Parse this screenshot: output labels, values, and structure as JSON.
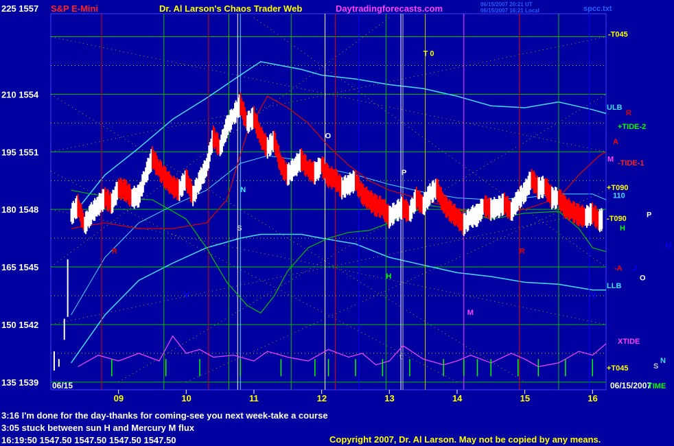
{
  "header": {
    "left_label": "225 1557",
    "instrument": "S&P E-Mini",
    "title": "Dr. Al Larson's Chaos Trader Web",
    "site": "Daytradingforecasts.com",
    "stamp_line1": "06/15/2007 20:21 UT",
    "stamp_line2": "06/15/2007 16:21 Local",
    "file": "spcc.txt"
  },
  "colors": {
    "background": "#0000a0",
    "price_up": "#ffffff",
    "price_down": "#ff0000",
    "grid_green": "#00c000",
    "grid_yellow": "#c8c800",
    "cyan": "#40e0ff",
    "magenta": "#ff40ff",
    "ma_red": "#e00000",
    "ma_green": "#00c000"
  },
  "chart_data": {
    "type": "line",
    "y_axis_labels": [
      {
        "label": "225 1557",
        "price": 1557
      },
      {
        "label": "210 1554",
        "price": 1554
      },
      {
        "label": "195 1551",
        "price": 1551
      },
      {
        "label": "180 1548",
        "price": 1548
      },
      {
        "label": "165 1545",
        "price": 1545
      },
      {
        "label": "150 1542",
        "price": 1542
      },
      {
        "label": "135 1539",
        "price": 1539
      }
    ],
    "ylim": [
      1538.6,
      1558.2
    ],
    "xlim": [
      8.0,
      16.2
    ],
    "x_ticks": [
      {
        "label": "09",
        "hour": 9
      },
      {
        "label": "10",
        "hour": 10
      },
      {
        "label": "11",
        "hour": 11
      },
      {
        "label": "12",
        "hour": 12
      },
      {
        "label": "13",
        "hour": 13
      },
      {
        "label": "14",
        "hour": 14
      },
      {
        "label": "15",
        "hour": 15
      },
      {
        "label": "16",
        "hour": 16
      }
    ],
    "date_left": "06/15",
    "date_right": "06/15/2007",
    "time_label": "TIME",
    "price_series": {
      "x": [
        8.3,
        8.4,
        8.5,
        8.6,
        8.7,
        8.8,
        8.9,
        9.0,
        9.1,
        9.2,
        9.3,
        9.4,
        9.5,
        9.6,
        9.7,
        9.8,
        9.9,
        10.0,
        10.1,
        10.2,
        10.3,
        10.4,
        10.5,
        10.6,
        10.7,
        10.8,
        10.9,
        11.0,
        11.1,
        11.2,
        11.3,
        11.4,
        11.5,
        11.6,
        11.7,
        11.8,
        11.9,
        12.0,
        12.1,
        12.2,
        12.3,
        12.4,
        12.5,
        12.6,
        12.7,
        12.8,
        12.9,
        13.0,
        13.1,
        13.2,
        13.3,
        13.4,
        13.5,
        13.6,
        13.7,
        13.8,
        13.9,
        14.0,
        14.1,
        14.2,
        14.3,
        14.4,
        14.5,
        14.6,
        14.7,
        14.8,
        14.9,
        15.0,
        15.1,
        15.2,
        15.3,
        15.4,
        15.5,
        15.6,
        15.7,
        15.8,
        15.9,
        16.0,
        16.1,
        16.15
      ],
      "y": [
        1547.7,
        1548.2,
        1547.2,
        1547.8,
        1548.2,
        1548.6,
        1548.3,
        1549.1,
        1549.0,
        1548.6,
        1548.7,
        1549.8,
        1550.7,
        1550.1,
        1549.6,
        1549.2,
        1549.0,
        1549.6,
        1548.7,
        1549.5,
        1550.2,
        1551.8,
        1551.2,
        1552.3,
        1552.9,
        1553.5,
        1552.5,
        1552.8,
        1551.8,
        1551.2,
        1551.6,
        1550.3,
        1549.8,
        1550.2,
        1550.6,
        1550.1,
        1549.9,
        1550.3,
        1549.7,
        1549.6,
        1549.1,
        1549.3,
        1549.5,
        1548.8,
        1548.5,
        1548.2,
        1548.1,
        1547.6,
        1547.9,
        1548.1,
        1547.8,
        1548.6,
        1548.2,
        1548.8,
        1549.1,
        1548.3,
        1547.9,
        1547.6,
        1547.2,
        1547.6,
        1547.7,
        1548.2,
        1548.0,
        1548.1,
        1548.3,
        1547.9,
        1548.5,
        1548.9,
        1549.6,
        1549.1,
        1549.2,
        1548.6,
        1548.6,
        1548.1,
        1547.9,
        1547.7,
        1547.6,
        1547.8,
        1547.4,
        1547.5
      ]
    },
    "opening_bars": {
      "x": [
        8.05,
        8.12,
        8.2,
        8.25
      ],
      "low": [
        1539.6,
        1539.8,
        1541.2,
        1542.4
      ],
      "high": [
        1540.6,
        1540.2,
        1542.3,
        1545.4
      ]
    },
    "ulb": {
      "x": [
        8.3,
        8.8,
        9.3,
        9.8,
        10.3,
        10.8,
        11.1,
        11.4,
        11.7,
        12.0,
        12.5,
        13.0,
        13.5,
        14.0,
        14.5,
        15.0,
        15.5,
        16.0,
        16.2
      ],
      "y": [
        1547.6,
        1549.8,
        1551.2,
        1552.7,
        1553.8,
        1555.0,
        1555.7,
        1555.5,
        1555.3,
        1555.0,
        1554.8,
        1554.5,
        1554.3,
        1553.9,
        1553.4,
        1553.3,
        1553.6,
        1553.2,
        1553.0
      ]
    },
    "llb": {
      "x": [
        8.3,
        8.8,
        9.3,
        9.8,
        10.3,
        10.8,
        11.1,
        11.4,
        11.7,
        12.0,
        12.5,
        13.0,
        13.5,
        14.0,
        14.5,
        15.0,
        15.5,
        16.0,
        16.2
      ],
      "y": [
        1540.0,
        1542.5,
        1544.3,
        1545.2,
        1546.0,
        1546.5,
        1546.7,
        1546.7,
        1546.7,
        1546.5,
        1546.2,
        1545.5,
        1545.1,
        1544.7,
        1544.5,
        1544.2,
        1544.1,
        1543.8,
        1543.8
      ]
    },
    "mid_cyan": {
      "x": [
        8.3,
        8.8,
        9.3,
        9.8,
        10.3,
        10.8,
        11.2,
        11.6,
        12.0,
        12.5,
        13.0,
        13.5,
        14.0,
        14.5,
        15.0,
        15.5,
        16.0,
        16.2
      ],
      "y": [
        1542.5,
        1545.5,
        1547.3,
        1548.2,
        1549.0,
        1550.4,
        1550.8,
        1550.6,
        1550.2,
        1549.8,
        1549.3,
        1548.9,
        1548.6,
        1548.5,
        1548.6,
        1548.8,
        1548.8,
        1548.5
      ]
    },
    "ma_red": {
      "x": [
        8.3,
        8.8,
        9.3,
        9.8,
        10.3,
        10.6,
        10.9,
        11.2,
        11.5,
        11.8,
        12.1,
        12.4,
        12.7,
        13.0,
        13.5,
        14.0,
        14.5,
        15.0,
        15.5,
        15.8,
        16.1,
        16.2
      ],
      "y": [
        1547.0,
        1547.3,
        1547.0,
        1547.0,
        1547.3,
        1548.5,
        1552.0,
        1553.9,
        1553.3,
        1552.5,
        1551.3,
        1550.3,
        1549.5,
        1549.0,
        1548.5,
        1548.0,
        1547.8,
        1548.0,
        1548.6,
        1549.8,
        1550.8,
        1551.0
      ]
    },
    "ma_green": {
      "x": [
        8.3,
        8.6,
        9.0,
        9.5,
        10.0,
        10.3,
        10.6,
        10.9,
        11.1,
        11.3,
        11.5,
        11.8,
        12.1,
        12.4,
        12.7,
        13.0,
        13.3,
        13.6,
        14.0,
        14.5,
        15.0,
        15.5,
        15.8,
        16.0,
        16.2
      ],
      "y": [
        1549.0,
        1548.8,
        1548.6,
        1548.5,
        1547.5,
        1546.0,
        1544.2,
        1543.0,
        1542.6,
        1543.5,
        1544.8,
        1546.0,
        1546.5,
        1546.8,
        1546.9,
        1547.3,
        1547.8,
        1548.2,
        1548.0,
        1547.5,
        1547.8,
        1547.9,
        1547.0,
        1546.0,
        1545.8
      ]
    },
    "xtide_level": {
      "x": [
        8.4,
        8.7,
        9.0,
        9.3,
        9.6,
        9.8,
        10.0,
        10.2,
        10.4,
        10.7,
        11.0,
        11.2,
        11.5,
        11.8,
        12.1,
        12.4,
        12.6,
        12.8,
        13.0,
        13.2,
        13.5,
        13.8,
        14.0,
        14.2,
        14.5,
        14.8,
        15.0,
        15.2,
        15.5,
        15.8,
        16.0,
        16.2
      ],
      "y": [
        1539.8,
        1540.4,
        1540.1,
        1540.5,
        1540.1,
        1541.4,
        1540.5,
        1540.7,
        1540.3,
        1540.4,
        1540.1,
        1540.6,
        1540.3,
        1540.1,
        1540.7,
        1540.3,
        1540.5,
        1539.9,
        1540.1,
        1540.9,
        1540.2,
        1539.9,
        1540.1,
        1540.4,
        1540.0,
        1540.5,
        1540.2,
        1539.8,
        1540.0,
        1540.6,
        1540.4,
        1541.0
      ]
    },
    "flux_spikes": [
      8.9,
      9.7,
      10.2,
      10.8,
      11.4,
      11.9,
      12.1,
      12.5,
      12.9,
      13.3,
      13.8,
      14.1,
      14.3,
      14.5,
      14.9,
      15.2,
      15.6,
      16.0
    ],
    "vertical_lines": [
      {
        "hour": 8.75,
        "color": "#e00000"
      },
      {
        "hour": 9.67,
        "color": "#00c000"
      },
      {
        "hour": 10.33,
        "color": "#e00000"
      },
      {
        "hour": 10.63,
        "color": "#00c000"
      },
      {
        "hour": 10.76,
        "color": "#ffffff"
      },
      {
        "hour": 10.8,
        "color": "#40e0ff"
      },
      {
        "hour": 11.55,
        "color": "#00c000"
      },
      {
        "hour": 12.05,
        "color": "#ffffff"
      },
      {
        "hour": 12.2,
        "color": "#e00000"
      },
      {
        "hour": 12.55,
        "color": "#0000ff"
      },
      {
        "hour": 12.95,
        "color": "#00c000"
      },
      {
        "hour": 13.17,
        "color": "#ffffff"
      },
      {
        "hour": 13.2,
        "color": "#c8c8c8"
      },
      {
        "hour": 13.53,
        "color": "#c8c800"
      },
      {
        "hour": 14.1,
        "color": "#ff40ff"
      },
      {
        "hour": 14.92,
        "color": "#e00000"
      },
      {
        "hour": 15.5,
        "color": "#00c000"
      },
      {
        "hour": 15.95,
        "color": "#0000ff"
      }
    ],
    "right_labels": [
      {
        "text": "-T045",
        "color": "#ffff00",
        "price": 1557.0
      },
      {
        "text": "ULB",
        "color": "#40e0ff",
        "price": 1553.2
      },
      {
        "text": "R",
        "color": "#e00000",
        "price": 1552.9
      },
      {
        "text": "+TIDE-2",
        "color": "#00ff00",
        "price": 1552.2
      },
      {
        "text": "A",
        "color": "#ff0000",
        "price": 1551.4
      },
      {
        "text": "M",
        "color": "#ff40ff",
        "price": 1550.5
      },
      {
        "text": "-TIDE-1",
        "color": "#ff2020",
        "price": 1550.3
      },
      {
        "text": "+T090",
        "color": "#ffff00",
        "price": 1549.0
      },
      {
        "text": "110",
        "color": "#40e0ff",
        "price": 1548.6
      },
      {
        "text": "-T090",
        "color": "#ffff00",
        "price": 1547.4
      },
      {
        "text": "P",
        "color": "#ffffff",
        "price": 1547.6
      },
      {
        "text": "H",
        "color": "#00ff00",
        "price": 1546.9
      },
      {
        "text": "U",
        "color": "#0000ff",
        "price": 1546.0
      },
      {
        "text": "-A",
        "color": "#ff0000",
        "price": 1544.8
      },
      {
        "text": "J",
        "color": "#0000ff",
        "price": 1544.8
      },
      {
        "text": "O",
        "color": "#ffffff",
        "price": 1544.3
      },
      {
        "text": "LLB",
        "color": "#40e0ff",
        "price": 1543.9
      },
      {
        "text": "XTIDE",
        "color": "#ff40ff",
        "price": 1541.0
      },
      {
        "text": "N",
        "color": "#40e0ff",
        "price": 1540.0
      },
      {
        "text": "S",
        "color": "#c8c8c8",
        "price": 1539.7
      },
      {
        "text": "+T045",
        "color": "#ffff00",
        "price": 1539.6
      }
    ],
    "chart_labels": [
      {
        "text": "T 0",
        "color": "#ffff00",
        "hour": 13.5,
        "price": 1556.0
      },
      {
        "text": "O",
        "color": "#ffffff",
        "hour": 12.05,
        "price": 1551.7
      },
      {
        "text": "P",
        "color": "#ffffff",
        "hour": 13.18,
        "price": 1549.8
      },
      {
        "text": "N",
        "color": "#40e0ff",
        "hour": 10.8,
        "price": 1548.9
      },
      {
        "text": "S",
        "color": "#c8c8c8",
        "hour": 10.75,
        "price": 1546.9
      },
      {
        "text": "R",
        "color": "#e00000",
        "hour": 8.9,
        "price": 1545.7
      },
      {
        "text": "R",
        "color": "#e00000",
        "hour": 14.92,
        "price": 1545.7
      },
      {
        "text": "H",
        "color": "#00ff00",
        "hour": 12.95,
        "price": 1544.4
      },
      {
        "text": "V",
        "color": "#0000ff",
        "hour": 9.97,
        "price": 1543.4
      },
      {
        "text": "V",
        "color": "#0000ff",
        "hour": 15.98,
        "price": 1543.4
      },
      {
        "text": "M",
        "color": "#ff40ff",
        "hour": 14.15,
        "price": 1542.5
      },
      {
        "text": "t",
        "color": "#c8c8c8",
        "hour": 13.15,
        "price": 1540.2
      }
    ]
  },
  "messages": {
    "line1": "3:16 I'm done for the day-thanks for coming-see you next week-take a course",
    "line2": "3:05 stuck between sun H and Mercury M flux",
    "quote": "16:19:50  1547.50  1547.50  1547.50  1547.50"
  },
  "footer": {
    "copyright": "Copyright 2007, Dr. Al Larson. May not be copied by any means."
  }
}
